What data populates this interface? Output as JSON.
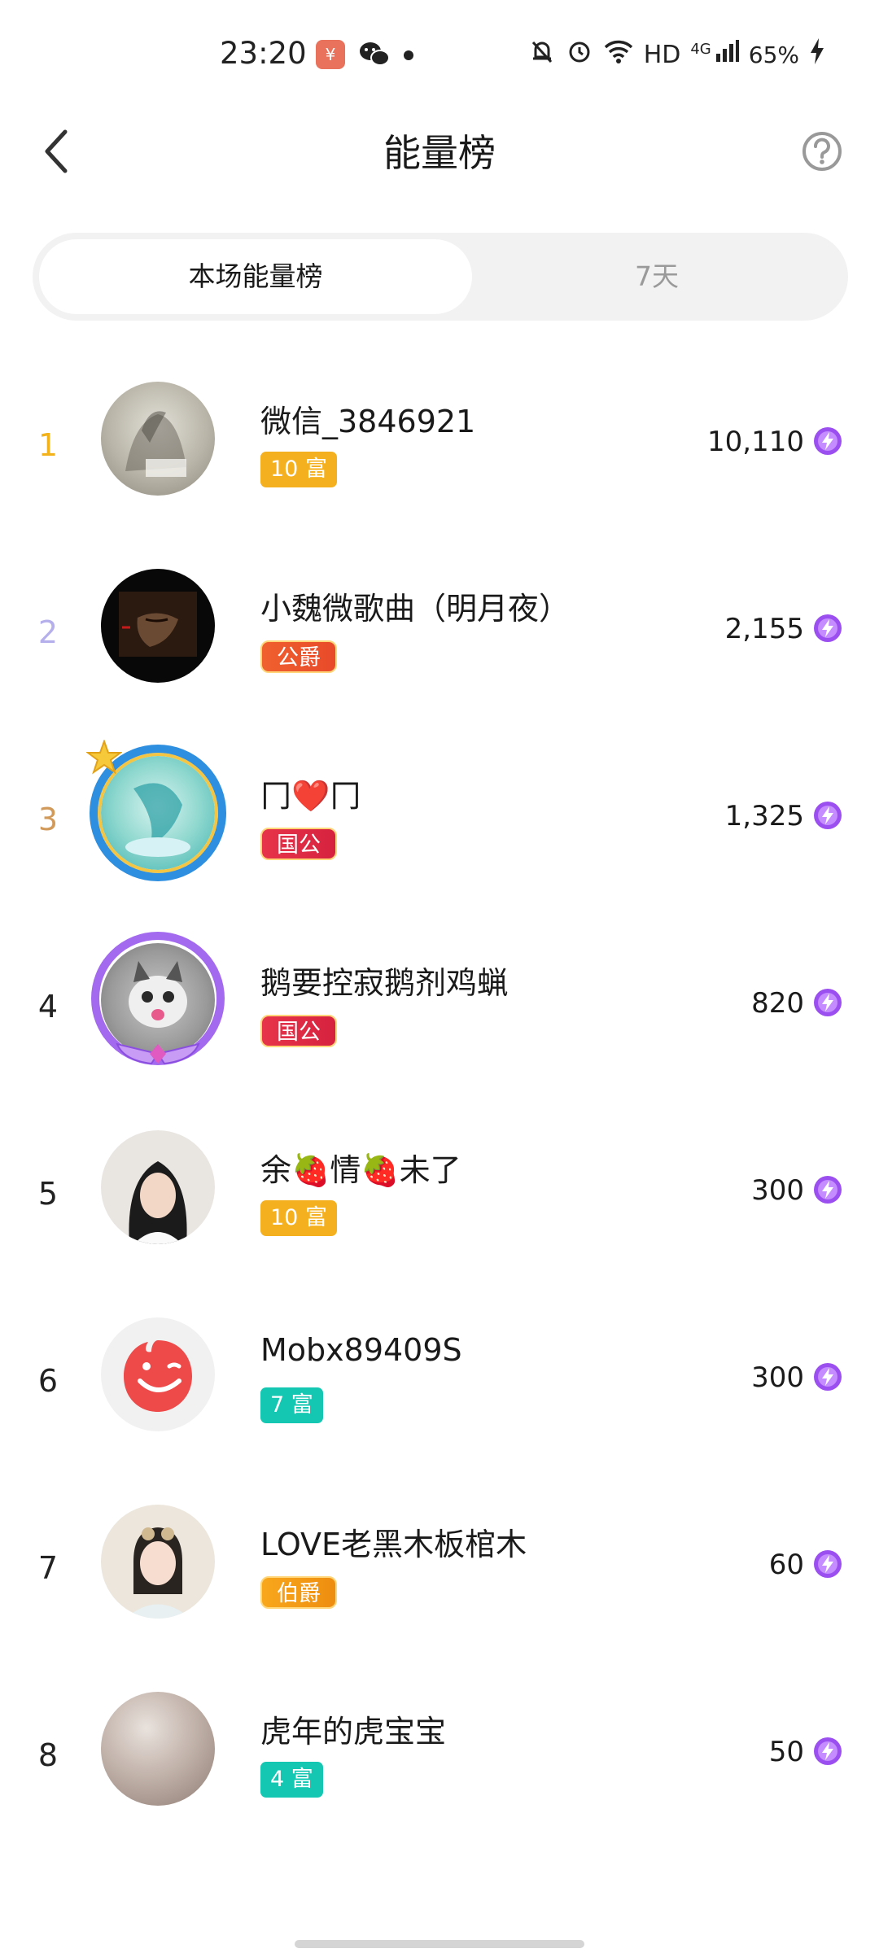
{
  "status_bar": {
    "time": "23:20",
    "app_badge_symbol": "¥",
    "network": "HD",
    "signal": "4G",
    "battery": "65%",
    "icons": [
      "mute-bell-icon",
      "alarm-icon",
      "wifi-icon",
      "signal-icon",
      "charging-icon"
    ]
  },
  "header": {
    "title": "能量榜",
    "back_icon": "chevron-left-icon",
    "help_icon": "help-icon"
  },
  "tabs": [
    {
      "label": "本场能量榜",
      "active": true
    },
    {
      "label": "7天",
      "active": false
    }
  ],
  "rankings": [
    {
      "rank": "1",
      "name": "微信_3846921",
      "badge": "10 富",
      "score": "10,110"
    },
    {
      "rank": "2",
      "name": "小魏微歌曲（明月夜）",
      "badge": "公爵",
      "score": "2,155"
    },
    {
      "rank": "3",
      "name": "冂❤️冂",
      "badge": "国公",
      "score": "1,325"
    },
    {
      "rank": "4",
      "name": "鹅要控寂鹅剂鸡蝋",
      "badge": "国公",
      "score": "820"
    },
    {
      "rank": "5",
      "name": "余🍓情🍓未了",
      "badge": "10 富",
      "score": "300"
    },
    {
      "rank": "6",
      "name": "Mobx89409S",
      "badge": "7 富",
      "score": "300"
    },
    {
      "rank": "7",
      "name": "LOVE老黑木板棺木",
      "badge": "伯爵",
      "score": "60"
    },
    {
      "rank": "8",
      "name": "虎年的虎宝宝",
      "badge": "4 富",
      "score": "50"
    }
  ],
  "colors": {
    "rank1": "#f2b21c",
    "rank2": "#b5b0ec",
    "rank3": "#d29a5a",
    "energy": "#9b4ff0",
    "badge_orange": "#f5b020",
    "badge_teal": "#14c7b2"
  }
}
